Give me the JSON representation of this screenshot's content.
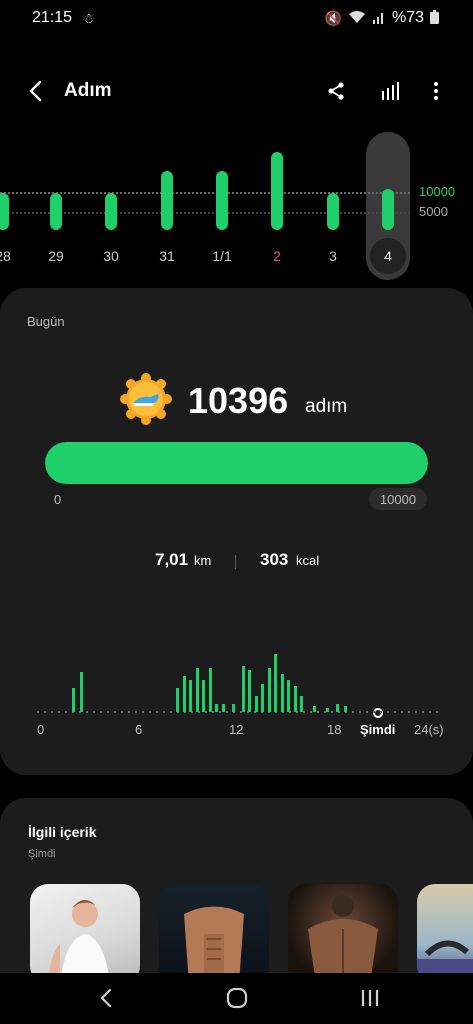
{
  "status_bar": {
    "time": "21:15",
    "battery_text": "%73",
    "icons": [
      "notification-icon",
      "mute-icon",
      "wifi-icon",
      "signal-icon",
      "battery-icon"
    ]
  },
  "header": {
    "title": "Adım",
    "icons": [
      "back-icon",
      "share-icon",
      "chart-icon",
      "more-icon"
    ]
  },
  "week": {
    "days": [
      {
        "label": "28",
        "steps_fraction": 0.45,
        "weekend": false
      },
      {
        "label": "29",
        "steps_fraction": 0.45,
        "weekend": false
      },
      {
        "label": "30",
        "steps_fraction": 0.45,
        "weekend": false
      },
      {
        "label": "31",
        "steps_fraction": 0.72,
        "weekend": false
      },
      {
        "label": "1/1",
        "steps_fraction": 0.72,
        "weekend": false
      },
      {
        "label": "2",
        "steps_fraction": 0.95,
        "weekend": true
      },
      {
        "label": "3",
        "steps_fraction": 0.45,
        "weekend": false
      },
      {
        "label": "4",
        "steps_fraction": 0.5,
        "weekend": false,
        "selected": true
      }
    ],
    "guide_high": "10000",
    "guide_low": "5000"
  },
  "today": {
    "label": "Bugün",
    "steps": "10396",
    "unit": "adım",
    "progress_fraction": 1.0,
    "progress_min": "0",
    "progress_max": "10000",
    "distance_value": "7,01",
    "distance_unit": "km",
    "calories_value": "303",
    "calories_unit": "kcal"
  },
  "hourly": {
    "ticks": [
      "0",
      "6",
      "12",
      "18"
    ],
    "end_label": "24(s)",
    "now_label": "Şimdi",
    "bars": [
      {
        "hour": 2.0,
        "level": 0.3
      },
      {
        "hour": 2.5,
        "level": 0.5
      },
      {
        "hour": 8.4,
        "level": 0.3
      },
      {
        "hour": 8.8,
        "level": 0.45
      },
      {
        "hour": 9.2,
        "level": 0.4
      },
      {
        "hour": 9.6,
        "level": 0.55
      },
      {
        "hour": 10.0,
        "level": 0.4
      },
      {
        "hour": 10.4,
        "level": 0.55
      },
      {
        "hour": 10.8,
        "level": 0.1
      },
      {
        "hour": 11.2,
        "level": 0.1
      },
      {
        "hour": 11.8,
        "level": 0.1
      },
      {
        "hour": 12.4,
        "level": 0.58
      },
      {
        "hour": 12.8,
        "level": 0.52
      },
      {
        "hour": 13.2,
        "level": 0.2
      },
      {
        "hour": 13.6,
        "level": 0.35
      },
      {
        "hour": 14.0,
        "level": 0.55
      },
      {
        "hour": 14.4,
        "level": 0.72
      },
      {
        "hour": 14.8,
        "level": 0.48
      },
      {
        "hour": 15.2,
        "level": 0.4
      },
      {
        "hour": 15.6,
        "level": 0.32
      },
      {
        "hour": 16.0,
        "level": 0.2
      },
      {
        "hour": 16.8,
        "level": 0.08
      },
      {
        "hour": 17.6,
        "level": 0.05
      },
      {
        "hour": 18.2,
        "level": 0.1
      },
      {
        "hour": 18.7,
        "level": 0.08
      }
    ],
    "now_hour": 20.5
  },
  "related": {
    "title": "İlgili içerik",
    "subtitle": "Şimdi"
  },
  "colors": {
    "accent": "#1ecf6a",
    "card": "#1c1c1c",
    "weekend": "#e25a5a"
  }
}
